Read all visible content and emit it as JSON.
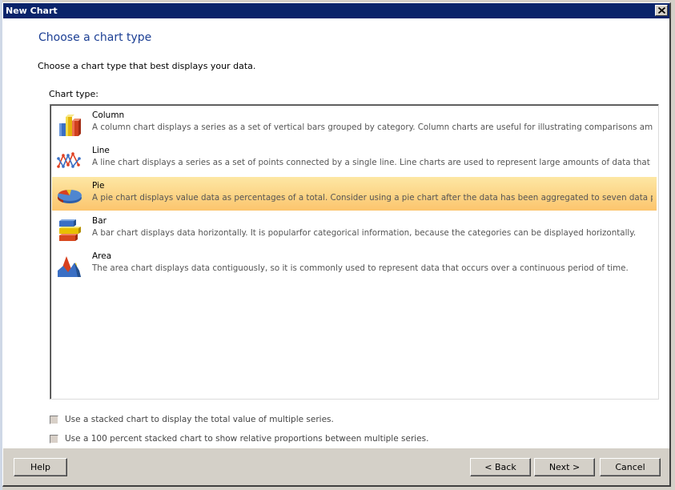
{
  "window": {
    "title": "New Chart",
    "close_icon": "close-icon"
  },
  "header": {
    "title": "Choose a chart type",
    "description": "Choose a chart type that best displays your data."
  },
  "chart_type_list": {
    "label": "Chart type:",
    "selected": "Pie",
    "items": [
      {
        "name": "Column",
        "icon": "column-chart-icon",
        "description": "A column chart displays a series as a set of vertical bars grouped by category. Column charts are useful for illustrating comparisons amon..."
      },
      {
        "name": "Line",
        "icon": "line-chart-icon",
        "description": "A line chart displays a series as a set of points connected by a single line. Line charts are used to represent large amounts of data that occ..."
      },
      {
        "name": "Pie",
        "icon": "pie-chart-icon",
        "description": "A pie chart displays value data as percentages of a total. Consider using a pie chart after the data has been aggregated to seven data poi..."
      },
      {
        "name": "Bar",
        "icon": "bar-chart-icon",
        "description": "A bar chart displays data horizontally. It is popularfor categorical information, because the categories can be displayed horizontally."
      },
      {
        "name": "Area",
        "icon": "area-chart-icon",
        "description": "The area chart displays data contiguously,  so it is commonly used to represent data that occurs over a continuous period of time."
      }
    ]
  },
  "options": {
    "stacked": {
      "label": "Use a stacked chart to display the total value of multiple series.",
      "checked": false,
      "enabled": false
    },
    "percent_stacked": {
      "label": "Use a 100 percent stacked chart to show relative proportions between multiple series.",
      "checked": false,
      "enabled": false
    }
  },
  "footer": {
    "help_label": "Help",
    "back_label": "< Back",
    "next_label": "Next >",
    "cancel_label": "Cancel"
  },
  "colors": {
    "title_bar": "#0a246a",
    "heading": "#1c3f94",
    "selection_top": "#fde7a4",
    "selection_bottom": "#fcc56d"
  }
}
